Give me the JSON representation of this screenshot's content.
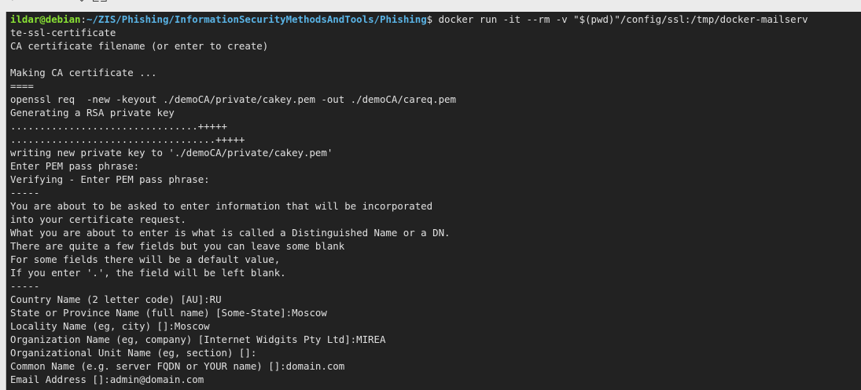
{
  "window": {
    "top_fragments": [
      "⌐",
      "⌄  ⊏⊐"
    ]
  },
  "prompt": {
    "user_host": "ildar@debian",
    "colon": ":",
    "path": "~/ZIS/Phishing/InformationSecurityMethodsAndTools/Phishing",
    "sign": "$ ",
    "command": "docker run -it --rm -v \"$(pwd)\"/config/ssl:/tmp/docker-mailserv"
  },
  "output_lines": [
    "te-ssl-certificate",
    "CA certificate filename (or enter to create)",
    "",
    "Making CA certificate ...",
    "====",
    "openssl req  -new -keyout ./demoCA/private/cakey.pem -out ./demoCA/careq.pem",
    "Generating a RSA private key",
    "................................+++++",
    "...................................+++++",
    "writing new private key to './demoCA/private/cakey.pem'",
    "Enter PEM pass phrase:",
    "Verifying - Enter PEM pass phrase:",
    "-----",
    "You are about to be asked to enter information that will be incorporated",
    "into your certificate request.",
    "What you are about to enter is what is called a Distinguished Name or a DN.",
    "There are quite a few fields but you can leave some blank",
    "For some fields there will be a default value,",
    "If you enter '.', the field will be left blank.",
    "-----",
    "Country Name (2 letter code) [AU]:RU",
    "State or Province Name (full name) [Some-State]:Moscow",
    "Locality Name (eg, city) []:Moscow",
    "Organization Name (eg, company) [Internet Widgits Pty Ltd]:MIREA",
    "Organizational Unit Name (eg, section) []:",
    "Common Name (e.g. server FQDN or YOUR name) []:domain.com",
    "Email Address []:admin@domain.com"
  ]
}
